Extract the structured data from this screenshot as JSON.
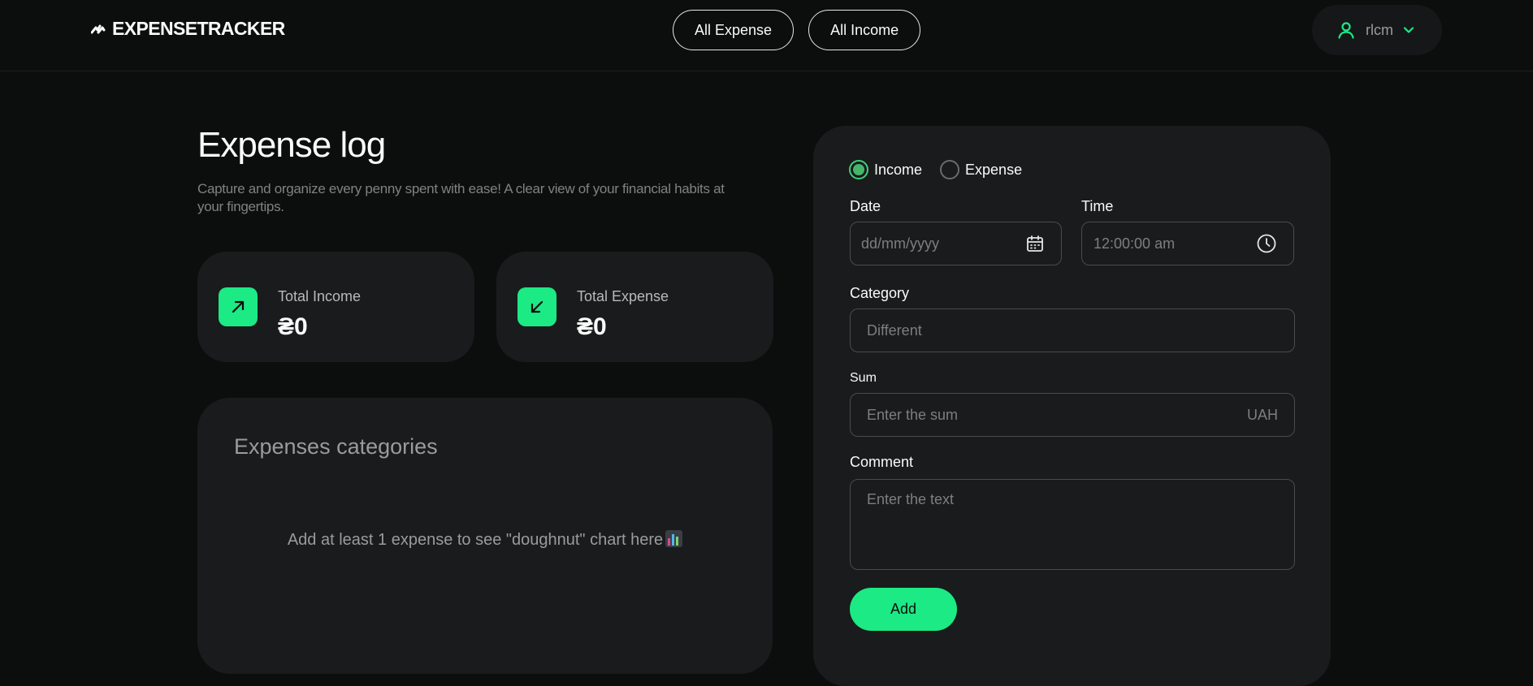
{
  "app": {
    "logo_text": "EXPENSETRACKER",
    "accent_color": "#1bea85"
  },
  "nav": {
    "all_expense": "All Expense",
    "all_income": "All Income"
  },
  "user": {
    "name": "rlcm",
    "icon": "user-icon"
  },
  "page": {
    "title": "Expense log",
    "description": "Capture and organize every penny spent with ease! A clear view of your financial habits at your fingertips."
  },
  "stats": {
    "income": {
      "label": "Total Income",
      "value": "₴0",
      "icon": "arrow-up-right-icon"
    },
    "expense": {
      "label": "Total Expense",
      "value": "₴0",
      "icon": "arrow-down-left-icon"
    }
  },
  "categories": {
    "title": "Expenses categories",
    "empty_message": "Add at least 1 expense to see \"doughnut\" chart here",
    "empty_icon": "bar-chart-emoji-icon"
  },
  "form": {
    "type_options": [
      {
        "label": "Income",
        "selected": true
      },
      {
        "label": "Expense",
        "selected": false
      }
    ],
    "date": {
      "label": "Date",
      "placeholder": "dd/mm/yyyy",
      "icon": "calendar-icon"
    },
    "time": {
      "label": "Time",
      "value": "12:00:00 am",
      "icon": "clock-icon"
    },
    "category": {
      "label": "Category",
      "value": "Different"
    },
    "sum": {
      "label": "Sum",
      "placeholder": "Enter the sum",
      "currency": "UAH"
    },
    "comment": {
      "label": "Comment",
      "placeholder": "Enter the text"
    },
    "submit_label": "Add"
  }
}
